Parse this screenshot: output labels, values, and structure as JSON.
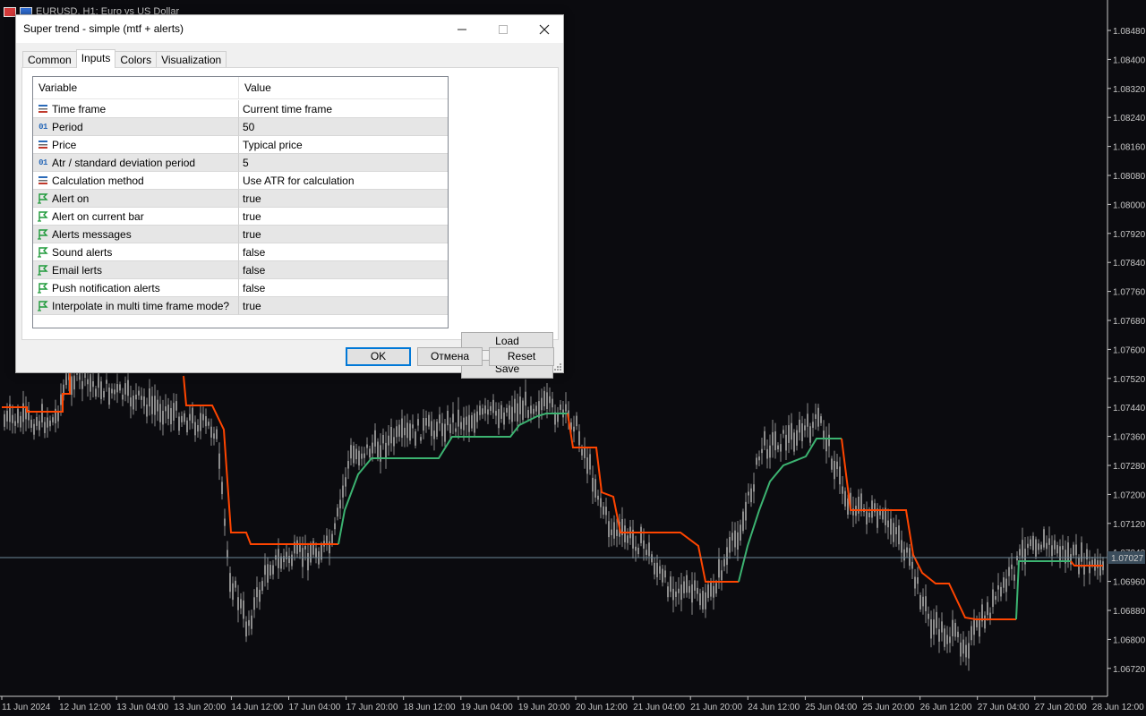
{
  "chart": {
    "title": "EURUSD, H1:  Euro vs US Dollar",
    "current_price": "1.07027",
    "price_labels": [
      "1.08480",
      "1.08400",
      "1.08320",
      "1.08240",
      "1.08160",
      "1.08080",
      "1.08000",
      "1.07920",
      "1.07840",
      "1.07760",
      "1.07680",
      "1.07600",
      "1.07520",
      "1.07440",
      "1.07360",
      "1.07280",
      "1.07200",
      "1.07120",
      "1.07040",
      "1.06960",
      "1.06880",
      "1.06800",
      "1.06720"
    ],
    "time_labels": [
      "11 Jun 2024",
      "12 Jun 12:00",
      "13 Jun 04:00",
      "13 Jun 20:00",
      "14 Jun 12:00",
      "17 Jun 04:00",
      "17 Jun 20:00",
      "18 Jun 12:00",
      "19 Jun 04:00",
      "19 Jun 20:00",
      "20 Jun 12:00",
      "21 Jun 04:00",
      "21 Jun 20:00",
      "24 Jun 12:00",
      "25 Jun 04:00",
      "25 Jun 20:00",
      "26 Jun 12:00",
      "27 Jun 04:00",
      "27 Jun 20:00",
      "28 Jun 12:00"
    ],
    "colors": {
      "background": "#0b0b0f",
      "candles": "#8c8c8c",
      "uptrend": "#3cb371",
      "downtrend": "#ff4500",
      "price_line": "#6e8a9a",
      "label_bg": "#3b4d5c"
    }
  },
  "dialog": {
    "title": "Super trend - simple (mtf + alerts)",
    "tabs": [
      {
        "label": "Common"
      },
      {
        "label": "Inputs"
      },
      {
        "label": "Colors"
      },
      {
        "label": "Visualization"
      }
    ],
    "active_tab": "Inputs",
    "grid": {
      "header_variable": "Variable",
      "header_value": "Value",
      "rows": [
        {
          "icon": "enum-icon",
          "variable": "Time frame",
          "value": "Current time frame"
        },
        {
          "icon": "number-icon",
          "icon_text": "01",
          "variable": "Period",
          "value": "50"
        },
        {
          "icon": "enum-icon",
          "variable": "Price",
          "value": "Typical price"
        },
        {
          "icon": "number-icon",
          "icon_text": "01",
          "variable": "Atr / standard deviation period",
          "value": "5"
        },
        {
          "icon": "enum-icon",
          "variable": "Calculation method",
          "value": "Use ATR for calculation"
        },
        {
          "icon": "bool-icon",
          "variable": "Alert on",
          "value": "true"
        },
        {
          "icon": "bool-icon",
          "variable": "Alert on current bar",
          "value": "true"
        },
        {
          "icon": "bool-icon",
          "variable": "Alerts messages",
          "value": "true"
        },
        {
          "icon": "bool-icon",
          "variable": "Sound alerts",
          "value": "false"
        },
        {
          "icon": "bool-icon",
          "variable": "Email lerts",
          "value": "false"
        },
        {
          "icon": "bool-icon",
          "variable": "Push notification alerts",
          "value": "false"
        },
        {
          "icon": "bool-icon",
          "variable": "Interpolate in multi time frame mode?",
          "value": "true"
        }
      ]
    },
    "buttons": {
      "load": "Load",
      "save": "Save",
      "ok": "OK",
      "cancel": "Отмена",
      "reset": "Reset"
    }
  }
}
